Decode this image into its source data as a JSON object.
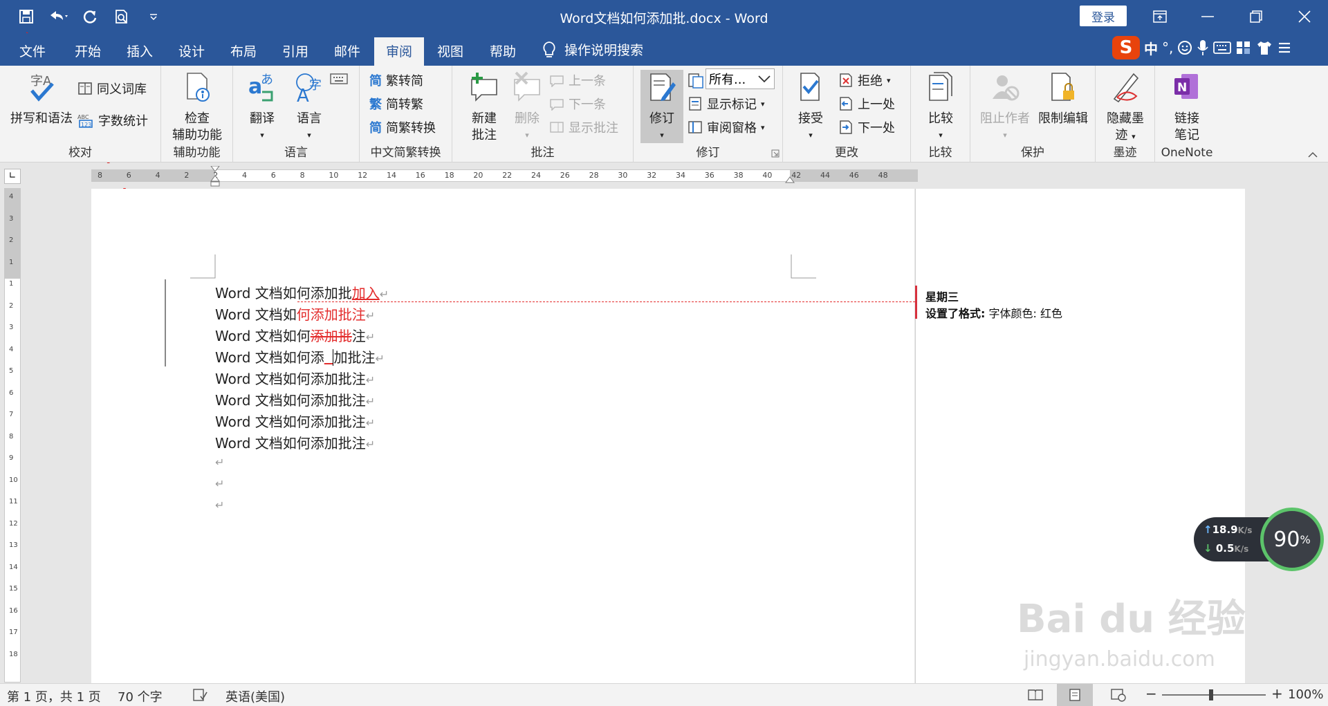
{
  "window": {
    "title": "Word文档如何添加批.docx  -  Word",
    "login_label": "登录"
  },
  "tabs": [
    {
      "label": "文件"
    },
    {
      "label": "开始"
    },
    {
      "label": "插入"
    },
    {
      "label": "设计"
    },
    {
      "label": "布局"
    },
    {
      "label": "引用"
    },
    {
      "label": "邮件"
    },
    {
      "label": "审阅"
    },
    {
      "label": "视图"
    },
    {
      "label": "帮助"
    }
  ],
  "search_tab": "操作说明搜索",
  "ime": {
    "mode": "中",
    "punct": "°,"
  },
  "ribbon": {
    "proofing": {
      "spelling": "拼写和语法",
      "thesaurus": "同义词库",
      "wordcount": "字数统计",
      "label": "校对"
    },
    "accessibility": {
      "check_line1": "检查",
      "check_line2": "辅助功能",
      "label": "辅助功能"
    },
    "language": {
      "translate": "翻译",
      "language": "语言",
      "label": "语言"
    },
    "chinese": {
      "t2s": "繁转简",
      "s2t": "简转繁",
      "convert": "简繁转换",
      "label": "中文简繁转换",
      "glyph1": "简",
      "glyph2": "繁",
      "glyph3": "简"
    },
    "comments": {
      "new_line1": "新建",
      "new_line2": "批注",
      "delete": "删除",
      "prev": "上一条",
      "next": "下一条",
      "show": "显示批注",
      "label": "批注"
    },
    "tracking": {
      "track": "修订",
      "markup_select": "所有...",
      "show_markup": "显示标记",
      "review_pane": "审阅窗格",
      "label": "修订"
    },
    "changes": {
      "accept": "接受",
      "reject": "拒绝",
      "prev": "上一处",
      "next": "下一处",
      "label": "更改"
    },
    "compare": {
      "compare": "比较",
      "label": "比较"
    },
    "protect": {
      "block": "阻止作者",
      "restrict": "限制编辑",
      "label": "保护"
    },
    "ink": {
      "hide_line1": "隐藏墨",
      "hide_line2": "迹",
      "label": "墨迹"
    },
    "onenote": {
      "link_line1": "链接",
      "link_line2": "笔记",
      "label": "OneNote"
    }
  },
  "ruler": {
    "ticks": [
      "8",
      "6",
      "4",
      "2",
      "2",
      "4",
      "6",
      "8",
      "10",
      "12",
      "14",
      "16",
      "18",
      "20",
      "22",
      "24",
      "26",
      "28",
      "30",
      "32",
      "34",
      "36",
      "38",
      "40",
      "42",
      "44",
      "46",
      "48"
    ],
    "vticks": [
      "4",
      "3",
      "2",
      "1",
      "1",
      "2",
      "3",
      "4",
      "5",
      "6",
      "7",
      "8",
      "9",
      "10",
      "11",
      "12",
      "13",
      "14",
      "15",
      "16",
      "17",
      "18"
    ]
  },
  "document": {
    "prefix": "Word 文档如何",
    "lines": [
      {
        "a": "Word 文档如何添加批",
        "ins": "加入",
        "b": ""
      },
      {
        "a": "Word 文档如",
        "ins": "何添加批注",
        "b": ""
      },
      {
        "a": "Word 文档如何",
        "del": "添加批",
        "b": "注"
      },
      {
        "a": "Word 文档如何添",
        "ins": "  ",
        "b": "加批注"
      },
      {
        "a": "Word 文档如何添加批注"
      },
      {
        "a": "Word 文档如何添加批注"
      },
      {
        "a": "Word 文档如何添加批注"
      },
      {
        "a": "Word 文档如何添加批注"
      }
    ],
    "paragraph_mark": "↵"
  },
  "balloon": {
    "author": "星期三",
    "change_label": "设置了格式:",
    "change_detail": " 字体颜色: 红色"
  },
  "status": {
    "page": "第 1 页，共 1 页",
    "words": "70 个字",
    "language": "英语(美国)",
    "zoom": "100%"
  },
  "speed_widget": {
    "upload": "18.9",
    "download": "0.5",
    "unit": "K/s",
    "percent": "90",
    "percent_sign": "%"
  },
  "watermark": {
    "line1": "Bai  du 经验",
    "line2": "jingyan.baidu.com"
  },
  "colors": {
    "accent": "#2b579a",
    "revision": "#e32c2c",
    "balloon_bar": "#d7303d"
  }
}
